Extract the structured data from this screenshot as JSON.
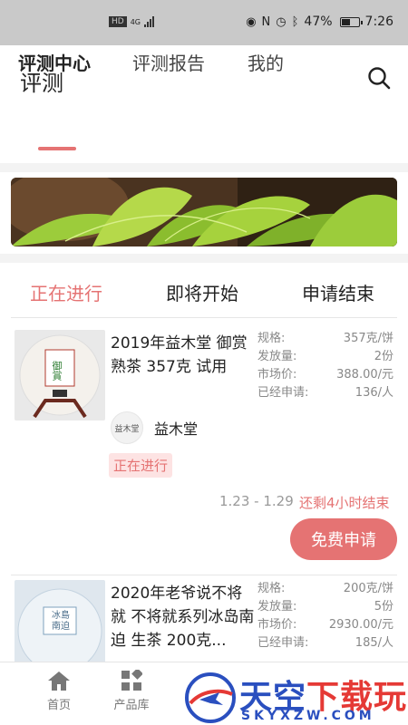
{
  "status_bar": {
    "network": "4G",
    "hd": "HD",
    "battery": "47%",
    "battery_level": 0.47,
    "time": "7:26"
  },
  "header": {
    "title": "评测",
    "search_icon": "search-icon"
  },
  "tabs": [
    {
      "label": "评测中心",
      "active": true
    },
    {
      "label": "评测报告",
      "active": false
    },
    {
      "label": "我的",
      "active": false
    }
  ],
  "status_tabs": [
    {
      "label": "正在进行",
      "active": true
    },
    {
      "label": "即将开始",
      "active": false
    },
    {
      "label": "申请结束",
      "active": false
    }
  ],
  "items": [
    {
      "title": "2019年益木堂 御赏 熟茶 357克 试用",
      "thumb_text": "御賞",
      "specs": [
        {
          "label": "规格:",
          "value": "357克/饼"
        },
        {
          "label": "发放量:",
          "value": "2份"
        },
        {
          "label": "市场价:",
          "value": "388.00/元"
        },
        {
          "label": "已经申请:",
          "value": "136/人"
        }
      ],
      "brand_logo_text": "益木堂",
      "brand_name": "益木堂",
      "badge": "正在进行",
      "date_range": "1.23 - 1.29",
      "remaining": "还剩4小时结束",
      "button": "免费申请"
    },
    {
      "title": "2020年老爷说不将就 不将就系列冰岛南迫 生茶 200克...",
      "thumb_text": "冰島 南迫",
      "specs": [
        {
          "label": "规格:",
          "value": "200克/饼"
        },
        {
          "label": "发放量:",
          "value": "5份"
        },
        {
          "label": "市场价:",
          "value": "2930.00/元"
        },
        {
          "label": "已经申请:",
          "value": "185/人"
        }
      ]
    }
  ],
  "bottom_nav": [
    {
      "label": "首页",
      "icon": "home-icon"
    },
    {
      "label": "产品库",
      "icon": "grid-icon"
    }
  ],
  "watermark": {
    "text_blue": "天空",
    "text_red": "下载玩",
    "url": "SKYXZW.COM"
  },
  "colors": {
    "accent": "#e57373",
    "badge_bg": "#fde3e3",
    "watermark_blue": "#2a4fbf"
  }
}
